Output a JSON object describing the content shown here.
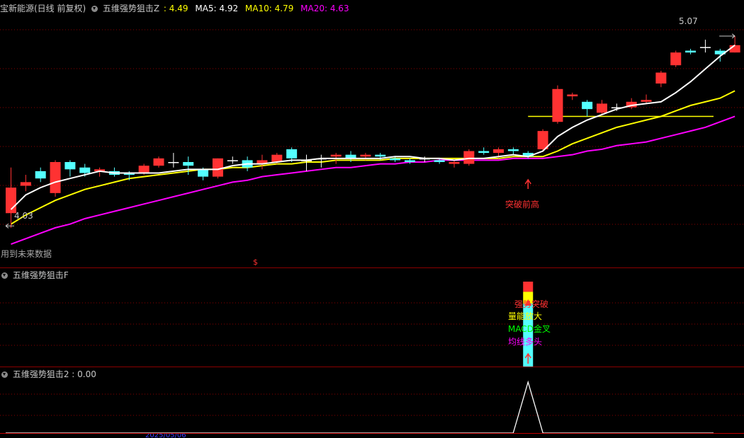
{
  "header": {
    "stock": "宝新能源(日线 前复权)",
    "indicator": "五维强势狙击Z",
    "z_label": ": 4.49",
    "ma5": "MA5: 4.92",
    "ma10": "MA10: 4.79",
    "ma20": "MA20: 4.63"
  },
  "panel2": {
    "title": "五维强势狙击F"
  },
  "panel3": {
    "title": "五维强势狙击2 : 0.00"
  },
  "annotations": {
    "high_label": "5.07",
    "low_label": "4.03",
    "future_note": "用到未来数据",
    "breakout": "突破前高",
    "dollar": "$",
    "signals": [
      "强势突破",
      "量能放大",
      "MACD金叉",
      "均线多头"
    ]
  },
  "axis": {
    "date_label": "2025/05/06"
  },
  "colors": {
    "up": "#ff3232",
    "down": "#54ffff",
    "ma5": "#ffffff",
    "ma10": "#ffff00",
    "ma20": "#ff00ff",
    "flat": "#ffff00",
    "grid": "#8b0000",
    "signal_up": "#ff3232"
  },
  "chart_data": {
    "type": "candlestick",
    "price_range": [
      3.88,
      5.19
    ],
    "candles": [
      [
        4.1,
        4.24,
        4.35,
        4.02
      ],
      [
        4.25,
        4.27,
        4.31,
        4.22
      ],
      [
        4.33,
        4.29,
        4.35,
        4.27
      ],
      [
        4.21,
        4.38,
        4.39,
        4.19
      ],
      [
        4.38,
        4.34,
        4.39,
        4.3
      ],
      [
        4.35,
        4.32,
        4.37,
        4.3
      ],
      [
        4.33,
        4.34,
        4.35,
        4.3
      ],
      [
        4.33,
        4.31,
        4.35,
        4.3
      ],
      [
        4.32,
        4.31,
        4.33,
        4.28
      ],
      [
        4.32,
        4.36,
        4.37,
        4.31
      ],
      [
        4.36,
        4.4,
        4.41,
        4.35
      ],
      [
        4.38,
        4.38,
        4.43,
        4.35
      ],
      [
        4.38,
        4.36,
        4.41,
        4.31
      ],
      [
        4.34,
        4.3,
        4.35,
        4.28
      ],
      [
        4.3,
        4.4,
        4.4,
        4.29
      ],
      [
        4.39,
        4.39,
        4.41,
        4.37
      ],
      [
        4.39,
        4.35,
        4.41,
        4.33
      ],
      [
        4.37,
        4.39,
        4.42,
        4.34
      ],
      [
        4.38,
        4.42,
        4.43,
        4.37
      ],
      [
        4.45,
        4.4,
        4.46,
        4.38
      ],
      [
        4.39,
        4.39,
        4.42,
        4.33
      ],
      [
        4.4,
        4.4,
        4.42,
        4.35
      ],
      [
        4.41,
        4.42,
        4.43,
        4.37
      ],
      [
        4.42,
        4.4,
        4.44,
        4.38
      ],
      [
        4.41,
        4.42,
        4.43,
        4.39
      ],
      [
        4.42,
        4.41,
        4.43,
        4.39
      ],
      [
        4.4,
        4.39,
        4.41,
        4.38
      ],
      [
        4.39,
        4.38,
        4.4,
        4.37
      ],
      [
        4.4,
        4.4,
        4.41,
        4.38
      ],
      [
        4.39,
        4.38,
        4.4,
        4.37
      ],
      [
        4.37,
        4.38,
        4.39,
        4.35
      ],
      [
        4.37,
        4.44,
        4.45,
        4.36
      ],
      [
        4.44,
        4.43,
        4.46,
        4.42
      ],
      [
        4.43,
        4.45,
        4.46,
        4.4
      ],
      [
        4.45,
        4.44,
        4.46,
        4.42
      ],
      [
        4.43,
        4.41,
        4.44,
        4.4
      ],
      [
        4.45,
        4.55,
        4.56,
        4.44
      ],
      [
        4.6,
        4.78,
        4.8,
        4.59
      ],
      [
        4.74,
        4.75,
        4.76,
        4.72
      ],
      [
        4.71,
        4.67,
        4.72,
        4.63
      ],
      [
        4.65,
        4.7,
        4.72,
        4.64
      ],
      [
        4.68,
        4.68,
        4.7,
        4.66
      ],
      [
        4.68,
        4.71,
        4.73,
        4.67
      ],
      [
        4.71,
        4.72,
        4.75,
        4.7
      ],
      [
        4.81,
        4.87,
        4.88,
        4.79
      ],
      [
        4.91,
        4.98,
        4.99,
        4.9
      ],
      [
        4.99,
        4.98,
        5.0,
        4.97
      ],
      [
        5.01,
        5.01,
        5.05,
        4.98
      ],
      [
        4.99,
        4.97,
        5.0,
        4.93
      ],
      [
        4.98,
        5.02,
        5.07,
        4.98
      ]
    ],
    "ma5": [
      4.12,
      4.2,
      4.24,
      4.27,
      4.29,
      4.31,
      4.33,
      4.32,
      4.32,
      4.32,
      4.32,
      4.33,
      4.34,
      4.34,
      4.34,
      4.36,
      4.37,
      4.37,
      4.38,
      4.39,
      4.39,
      4.4,
      4.4,
      4.4,
      4.4,
      4.4,
      4.41,
      4.41,
      4.4,
      4.4,
      4.39,
      4.4,
      4.4,
      4.41,
      4.42,
      4.41,
      4.44,
      4.52,
      4.57,
      4.61,
      4.64,
      4.67,
      4.69,
      4.7,
      4.71,
      4.76,
      4.82,
      4.89,
      4.96,
      5.02
    ],
    "ma10": [
      4.04,
      4.09,
      4.13,
      4.17,
      4.2,
      4.23,
      4.25,
      4.27,
      4.29,
      4.3,
      4.31,
      4.32,
      4.33,
      4.34,
      4.34,
      4.35,
      4.35,
      4.36,
      4.37,
      4.37,
      4.38,
      4.38,
      4.39,
      4.39,
      4.39,
      4.39,
      4.4,
      4.4,
      4.4,
      4.4,
      4.4,
      4.4,
      4.4,
      4.4,
      4.41,
      4.41,
      4.41,
      4.44,
      4.48,
      4.51,
      4.54,
      4.57,
      4.59,
      4.61,
      4.63,
      4.66,
      4.69,
      4.71,
      4.73,
      4.77
    ],
    "ma20": [
      3.93,
      3.96,
      3.99,
      4.02,
      4.04,
      4.07,
      4.09,
      4.11,
      4.13,
      4.15,
      4.17,
      4.19,
      4.21,
      4.23,
      4.25,
      4.27,
      4.28,
      4.3,
      4.31,
      4.32,
      4.33,
      4.34,
      4.35,
      4.35,
      4.36,
      4.37,
      4.37,
      4.38,
      4.38,
      4.39,
      4.39,
      4.39,
      4.39,
      4.39,
      4.4,
      4.4,
      4.4,
      4.41,
      4.42,
      4.44,
      4.45,
      4.47,
      4.48,
      4.49,
      4.51,
      4.53,
      4.55,
      4.57,
      4.6,
      4.63
    ],
    "flat_line": {
      "value": 4.63,
      "from_index": 35
    },
    "signal_index": 35,
    "signal_bar": {
      "colors": [
        "#ff3232",
        "#ffff00",
        "#54ffff"
      ],
      "levels": [
        1.0,
        0.88,
        0.74
      ]
    },
    "spike": {
      "index": 35,
      "value": 1
    }
  }
}
